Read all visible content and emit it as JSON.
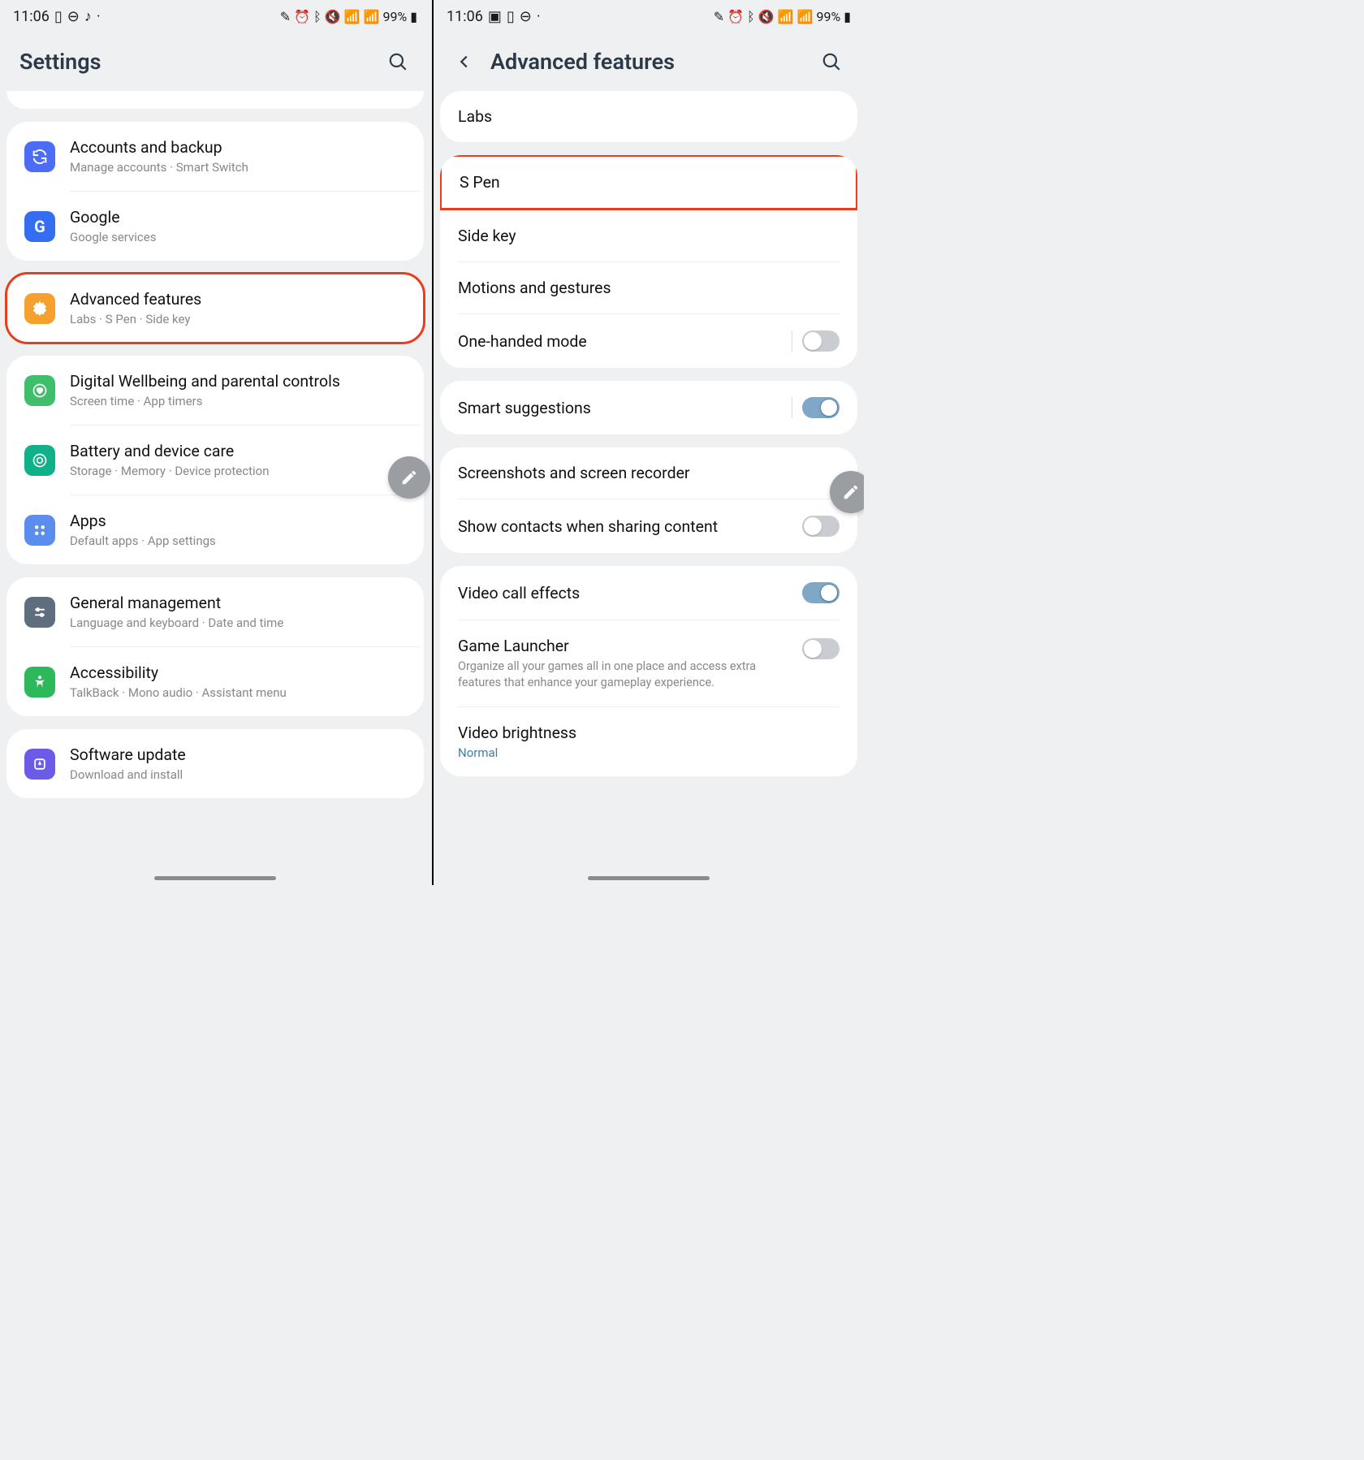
{
  "status": {
    "time": "11:06",
    "battery": "99%"
  },
  "left": {
    "title": "Settings",
    "groups": [
      {
        "rows": [
          {
            "label": "Accounts and backup",
            "sub": "Manage accounts  ·  Smart Switch",
            "icon": "sync",
            "color": "ic-blue"
          },
          {
            "label": "Google",
            "sub": "Google services",
            "icon": "google",
            "color": "ic-google"
          }
        ]
      },
      {
        "highlight": true,
        "rows": [
          {
            "label": "Advanced features",
            "sub": "Labs  ·  S Pen  ·  Side key",
            "icon": "gear",
            "color": "ic-orange"
          }
        ]
      },
      {
        "rows": [
          {
            "label": "Digital Wellbeing and parental controls",
            "sub": "Screen time  ·  App timers",
            "icon": "heart",
            "color": "ic-green"
          },
          {
            "label": "Battery and device care",
            "sub": "Storage  ·  Memory  ·  Device protection",
            "icon": "care",
            "color": "ic-teal"
          },
          {
            "label": "Apps",
            "sub": "Default apps  ·  App settings",
            "icon": "apps",
            "color": "ic-blue2"
          }
        ]
      },
      {
        "rows": [
          {
            "label": "General management",
            "sub": "Language and keyboard  ·  Date and time",
            "icon": "sliders",
            "color": "ic-grey"
          },
          {
            "label": "Accessibility",
            "sub": "TalkBack  ·  Mono audio  ·  Assistant menu",
            "icon": "a11y",
            "color": "ic-green2"
          }
        ]
      },
      {
        "rows": [
          {
            "label": "Software update",
            "sub": "Download and install",
            "icon": "update",
            "color": "ic-purple"
          }
        ]
      }
    ]
  },
  "right": {
    "title": "Advanced features",
    "groups": [
      {
        "rows": [
          {
            "label": "Labs"
          }
        ]
      },
      {
        "rows": [
          {
            "label": "S Pen",
            "highlight": true
          },
          {
            "label": "Side key"
          },
          {
            "label": "Motions and gestures"
          },
          {
            "label": "One-handed mode",
            "toggle": "off",
            "toggleSep": true
          }
        ]
      },
      {
        "rows": [
          {
            "label": "Smart suggestions",
            "toggle": "on",
            "toggleSep": true
          }
        ]
      },
      {
        "rows": [
          {
            "label": "Screenshots and screen recorder"
          },
          {
            "label": "Show contacts when sharing content",
            "toggle": "off"
          }
        ]
      },
      {
        "rows": [
          {
            "label": "Video call effects",
            "toggle": "on"
          },
          {
            "label": "Game Launcher",
            "desc": "Organize all your games all in one place and access extra features that enhance your gameplay experience.",
            "toggle": "off"
          },
          {
            "label": "Video brightness",
            "sub": "Normal",
            "subBlue": true
          }
        ]
      }
    ]
  }
}
